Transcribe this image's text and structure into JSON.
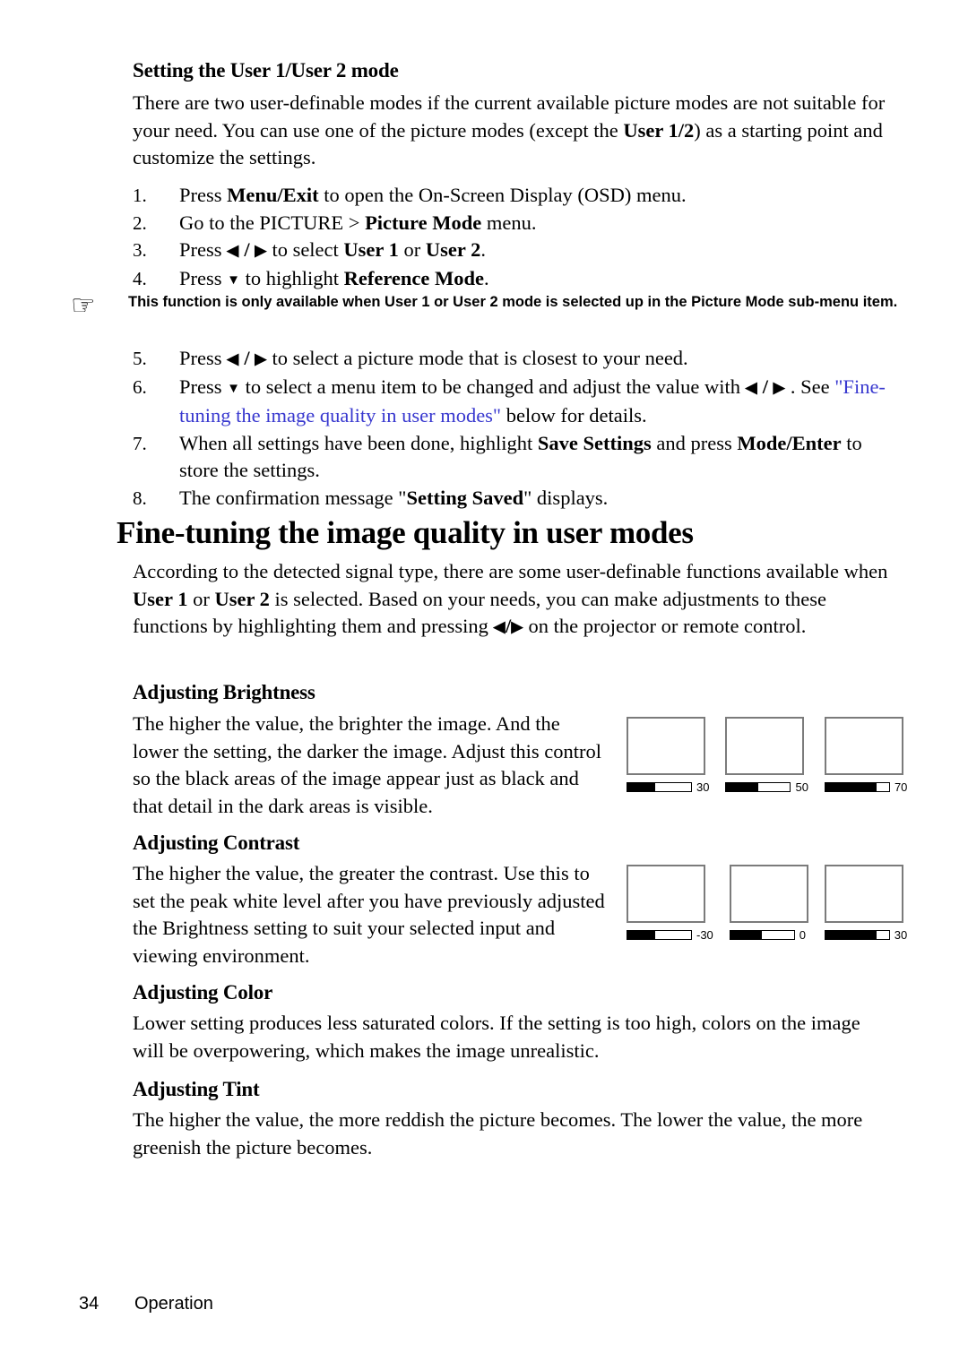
{
  "document": {
    "footer": {
      "page_number": "34",
      "section": "Operation"
    }
  },
  "sections": {
    "user_mode": {
      "heading": "Setting the User 1/User 2 mode",
      "intro_1": "There are two user-definable modes if the current available picture modes are not suitable for your need. You can use one of the picture modes (except the ",
      "intro_bold": "User 1/2",
      "intro_2": ") as a starting point and customize the settings.",
      "steps": [
        {
          "num": "1.",
          "parts": [
            "Press ",
            "Menu/Exit",
            " to open the On-Screen Display (OSD) menu."
          ]
        },
        {
          "num": "2.",
          "parts": [
            "Go to the PICTURE > ",
            "Picture Mode",
            " menu."
          ]
        },
        {
          "num": "3.",
          "parts": [
            "Press ",
            "◀",
            " / ",
            "▶",
            " to select ",
            "User 1",
            " or ",
            "User 2",
            "."
          ]
        },
        {
          "num": "4.",
          "parts": [
            "Press ",
            "▼",
            " to highlight ",
            "Reference Mode",
            "."
          ]
        },
        {
          "num": "5.",
          "parts": [
            "Press ",
            "◀",
            " / ",
            "▶",
            " to select a picture mode that is closest to your need."
          ]
        },
        {
          "num": "6.",
          "parts": [
            "Press ",
            "▼",
            " to select a menu item to be changed and adjust the value with ",
            "◀",
            " / ",
            "▶",
            " . See ",
            "\"Fine-tuning the image quality in user modes\"",
            " below for details."
          ]
        },
        {
          "num": "7.",
          "parts": [
            "When all settings have been done, highlight ",
            "Save Settings",
            " and press ",
            "Mode/Enter",
            " to store the settings."
          ]
        },
        {
          "num": "8.",
          "parts": [
            "The confirmation message \"",
            "Setting Saved",
            "\" displays."
          ]
        }
      ],
      "note": {
        "icon": "pointing-hand-icon",
        "text": "This function is only available when User 1 or User 2 mode is selected up in the Picture Mode sub-menu item."
      }
    },
    "fine_tuning": {
      "title": "Fine-tuning the image quality in user modes",
      "intro_a": "According to the detected signal type, there are some user-definable functions available when ",
      "intro_user1": "User 1",
      "intro_or": " or ",
      "intro_user2": "User 2",
      "intro_b": " is selected. Based on your needs, you can make adjustments to these functions by highlighting them and pressing ",
      "intro_c": " on the projector or remote control.",
      "brightness": {
        "heading": "Adjusting Brightness",
        "body": "The higher the value, the brighter the image. And the lower the setting, the darker the image. Adjust this control so the black areas of the image appear just as black and that detail in the dark areas is visible.",
        "samples": [
          {
            "value": "30",
            "fill_pct": 44
          },
          {
            "value": "50",
            "fill_pct": 50
          },
          {
            "value": "70",
            "fill_pct": 80
          }
        ]
      },
      "contrast": {
        "heading": "Adjusting Contrast",
        "body": "The higher the value, the greater the contrast. Use this to set the peak white level after you have previously adjusted the Brightness setting to suit your selected input and viewing environment.",
        "samples": [
          {
            "value": "-30",
            "fill_pct": 44
          },
          {
            "value": "0",
            "fill_pct": 50
          },
          {
            "value": "30",
            "fill_pct": 80
          }
        ]
      },
      "color": {
        "heading": "Adjusting Color",
        "body": "Lower setting produces less saturated colors. If the setting is too high, colors on the image will be overpowering, which makes the image unrealistic."
      },
      "tint": {
        "heading": "Adjusting Tint",
        "body": "The higher the value, the more reddish the picture becomes. The lower the value, the more greenish the picture becomes."
      }
    }
  },
  "colors": {
    "link": "#3838cf",
    "thumb_border": "#7b7b7b",
    "text": "#000000"
  }
}
